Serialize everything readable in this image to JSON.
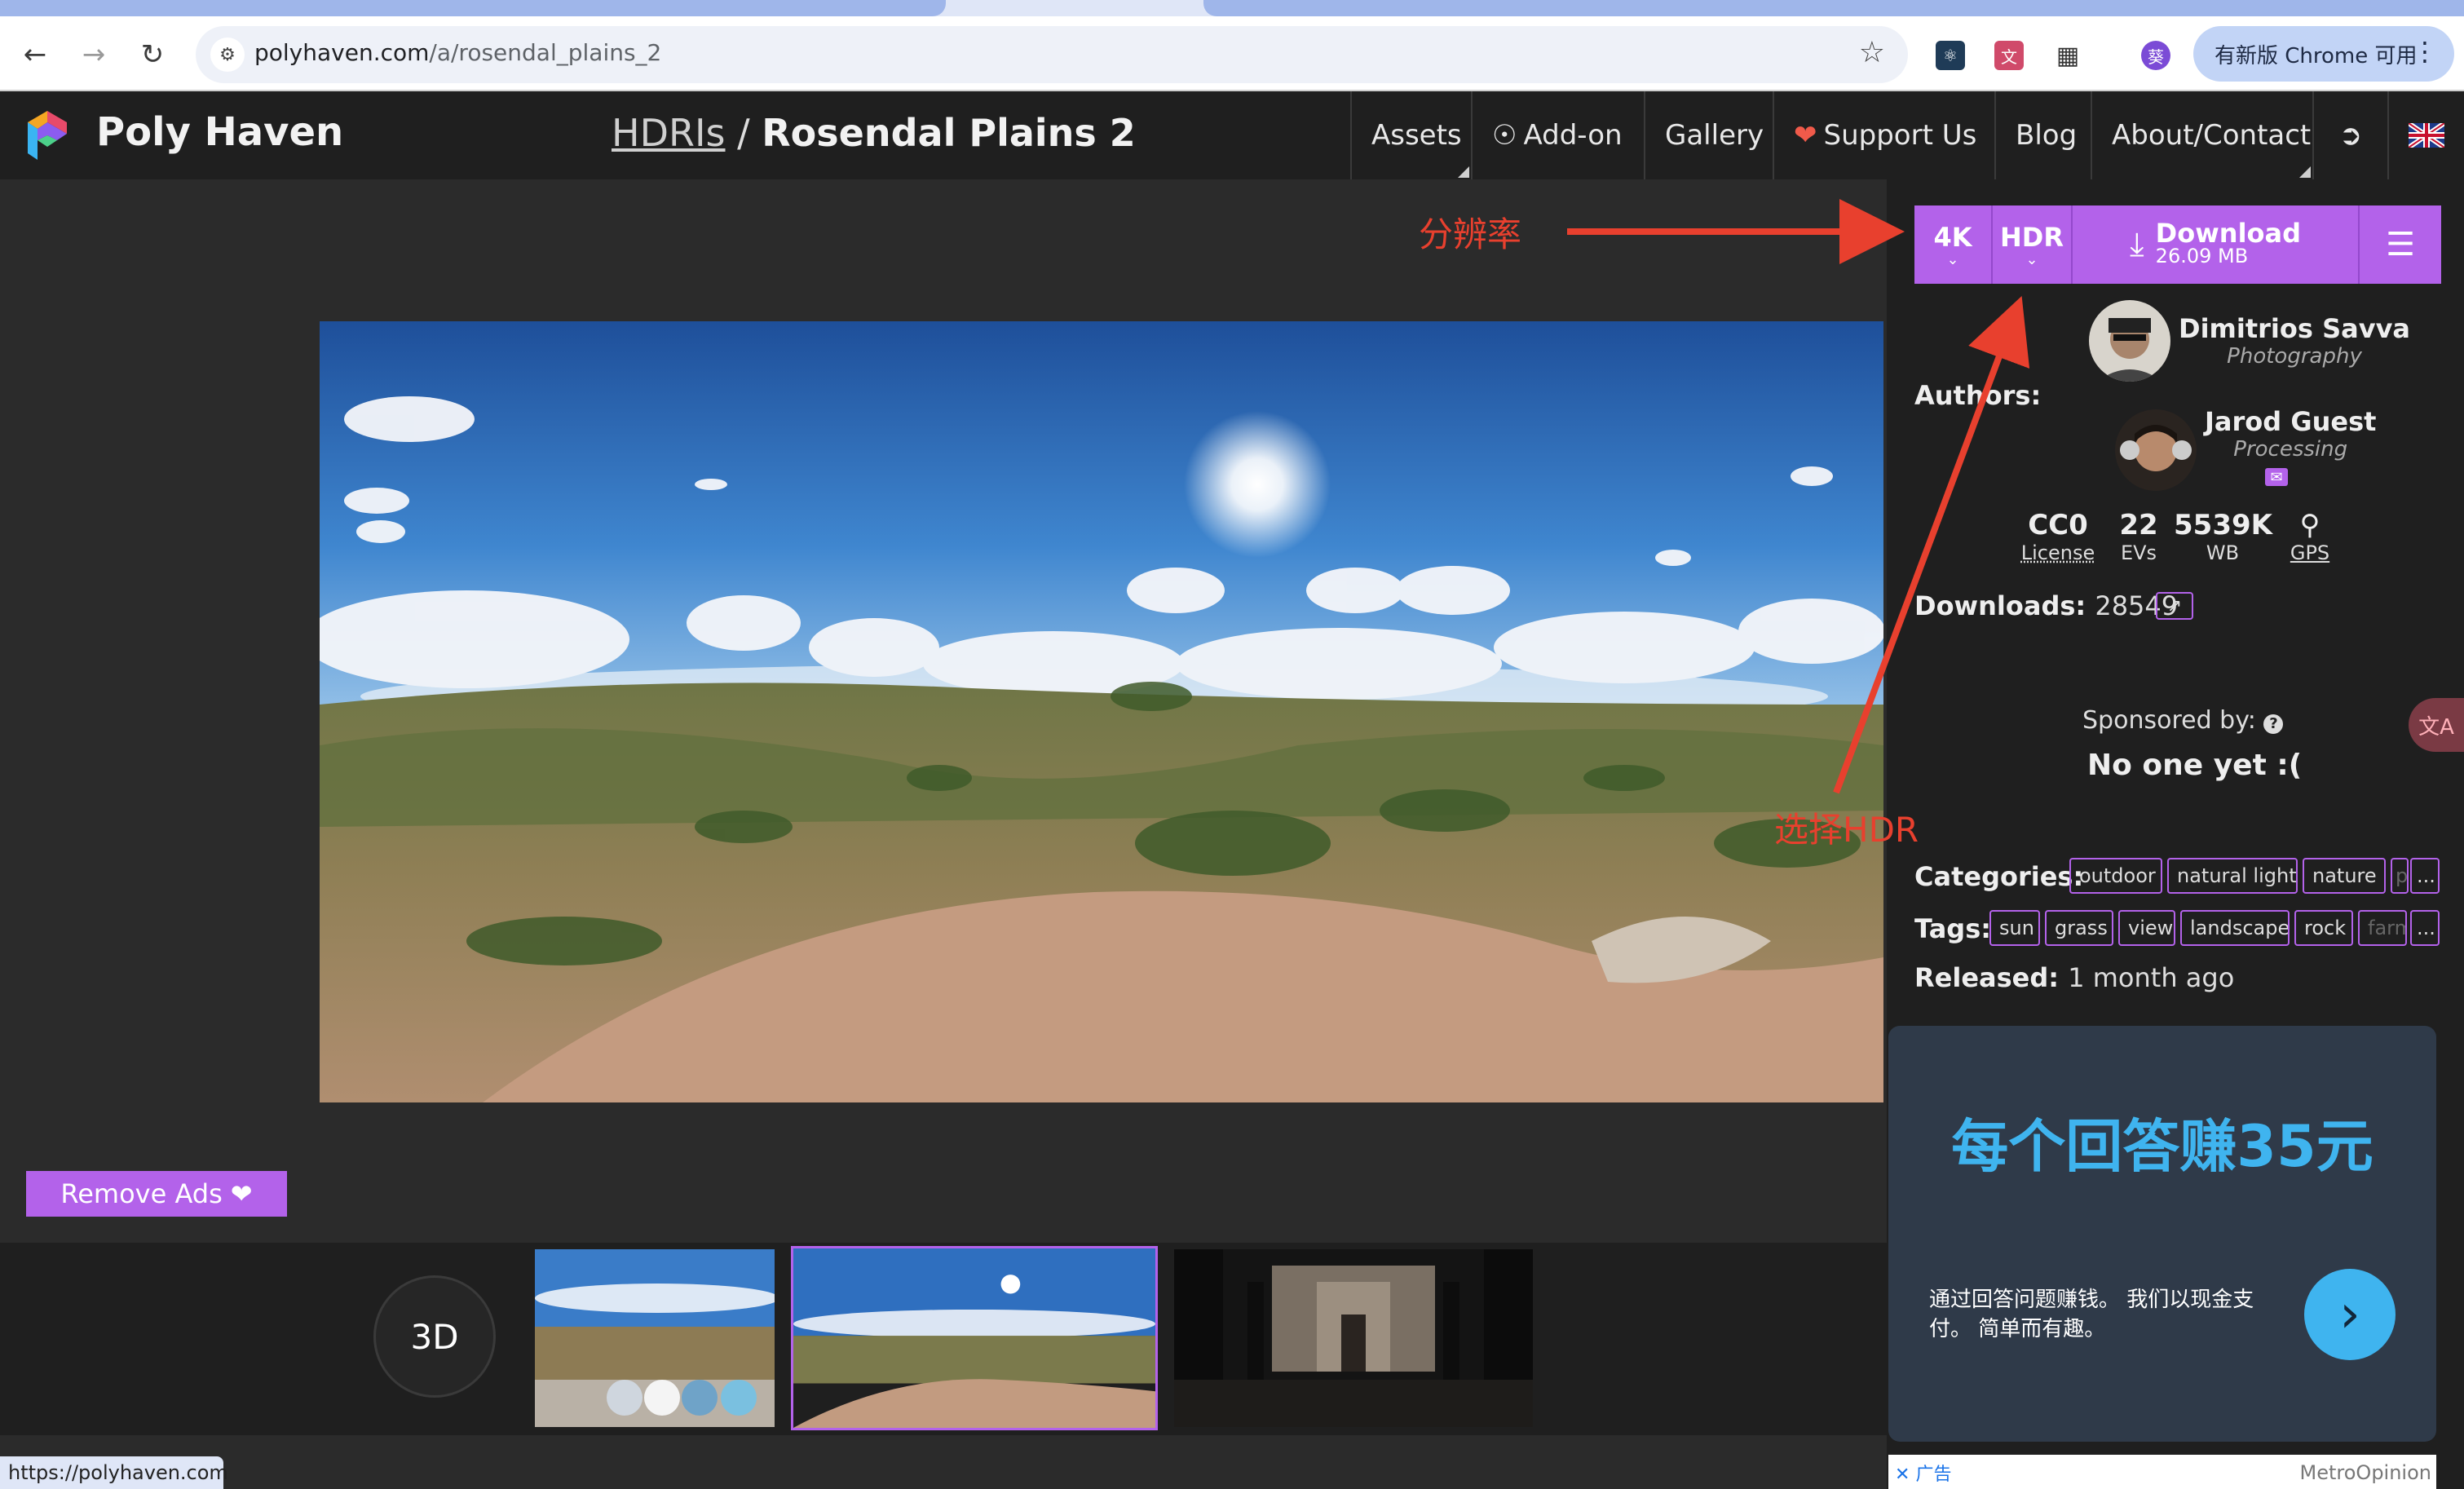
{
  "browser": {
    "url_host": "polyhaven.com",
    "url_path": "/a/rosendal_plains_2",
    "update_button": "有新版 Chrome 可用",
    "status_url": "https://polyhaven.com"
  },
  "site": {
    "brand": "Poly Haven",
    "breadcrumb": {
      "section": "HDRIs",
      "separator": " / ",
      "title": "Rosendal Plains 2"
    },
    "nav": [
      {
        "label": "Assets"
      },
      {
        "label": "Add-on"
      },
      {
        "label": "Gallery"
      },
      {
        "label": "Support Us"
      },
      {
        "label": "Blog"
      },
      {
        "label": "About/Contact"
      }
    ],
    "accent": "#b362ea"
  },
  "main": {
    "remove_ads": "Remove Ads",
    "btn_3d": "3D"
  },
  "download": {
    "resolution": "4K",
    "format": "HDR",
    "label": "Download",
    "size": "26.09 MB"
  },
  "authors": {
    "label": "Authors:",
    "list": [
      {
        "name": "Dimitrios Savva",
        "role": "Photography"
      },
      {
        "name": "Jarod Guest",
        "role": "Processing"
      }
    ]
  },
  "stats": [
    {
      "value": "CC0",
      "label": "License"
    },
    {
      "value": "22",
      "label": "EVs"
    },
    {
      "value": "5539K",
      "label": "WB"
    },
    {
      "value": "",
      "label": "GPS"
    }
  ],
  "downloads": {
    "label": "Downloads:",
    "value": "28549"
  },
  "sponsor": {
    "label": "Sponsored by:",
    "value": "No one yet :("
  },
  "categories": {
    "label": "Categories:",
    "items": [
      "outdoor",
      "natural light",
      "nature",
      "p",
      "..."
    ]
  },
  "tags": {
    "label": "Tags:",
    "items": [
      "sun",
      "grass",
      "view",
      "landscape",
      "rock",
      "farm",
      "..."
    ]
  },
  "released": {
    "label": "Released:",
    "value": "1 month ago"
  },
  "ad": {
    "headline": "每个回答赚35元",
    "body": "通过回答问题赚钱。 我们以现金支付。 简单而有趣。",
    "badge": "广告",
    "source": "MetroOpinion"
  },
  "annotations": {
    "resolution": "分辨率",
    "select_hdr": "选择HDR"
  }
}
